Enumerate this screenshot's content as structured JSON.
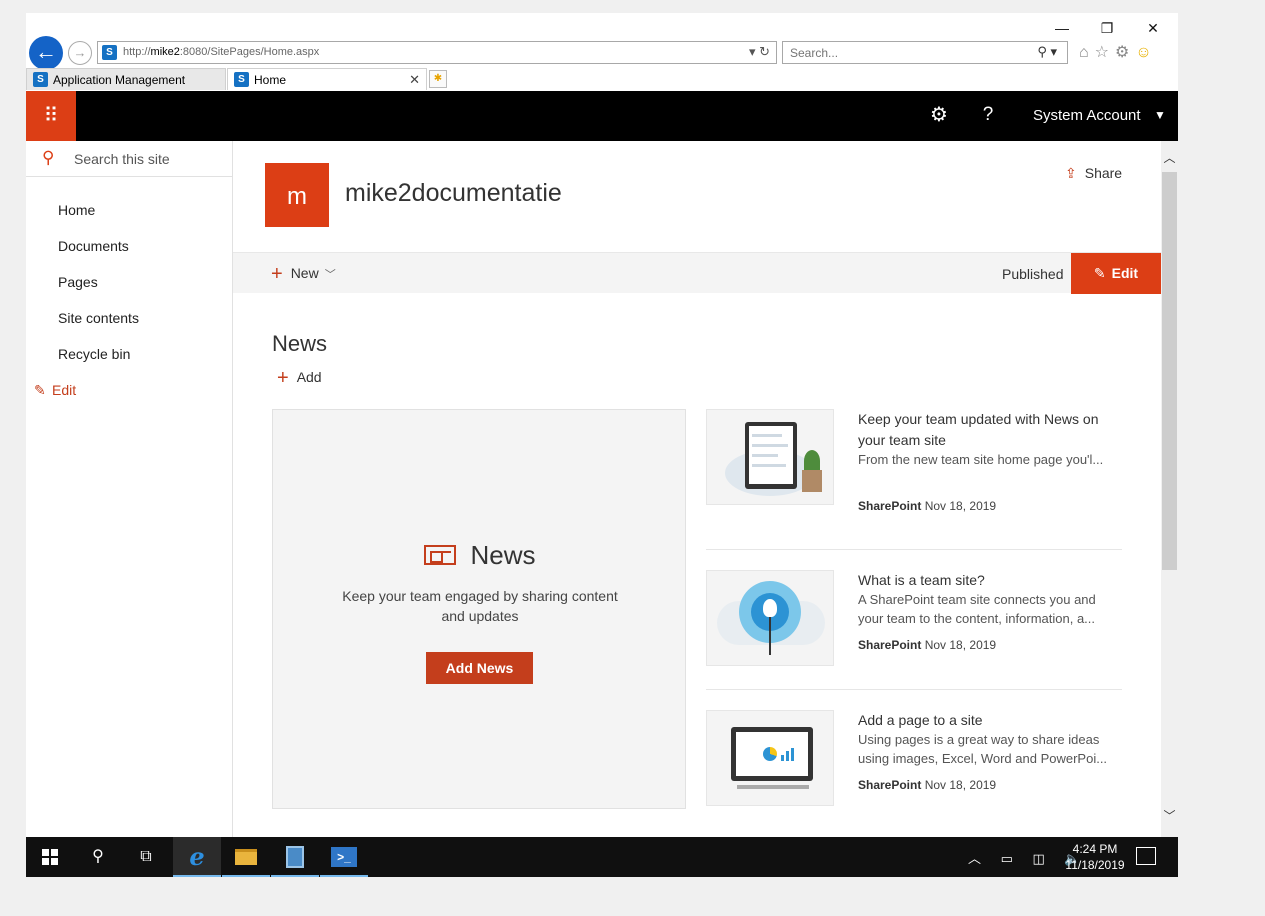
{
  "browser": {
    "window_controls": {
      "minimize": "—",
      "restore": "❐",
      "close": "✕"
    },
    "address": {
      "url_prefix": "http://",
      "url_host": "mike2",
      "url_rest": ":8080/SitePages/Home.aspx",
      "tools": "▾ ↻"
    },
    "search": {
      "placeholder": "Search...",
      "icon": "⚲ ▾"
    },
    "toolbar_icons": {
      "home": "⌂",
      "favorites": "☆",
      "settings": "⚙",
      "feedback": "☺"
    },
    "tabs": [
      {
        "label": "Application Management"
      },
      {
        "label": "Home",
        "close": "✕"
      }
    ],
    "new_tab": "✱"
  },
  "suite": {
    "waffle": "⠿",
    "settings_icon": "⚙",
    "help_icon": "?",
    "account": "System Account",
    "account_caret": "▼",
    "brand_color": "#dc3e15"
  },
  "leftnav": {
    "search_placeholder": "Search this site",
    "items": [
      {
        "label": "Home"
      },
      {
        "label": "Documents"
      },
      {
        "label": "Pages"
      },
      {
        "label": "Site contents"
      },
      {
        "label": "Recycle bin"
      }
    ],
    "edit": "Edit"
  },
  "site": {
    "logo_letter": "m",
    "title": "mike2documentatie",
    "share": "Share"
  },
  "commandbar": {
    "new_label": "New",
    "status": "Published",
    "edit": "Edit"
  },
  "news": {
    "heading": "News",
    "add_label": "Add",
    "hero": {
      "title": "News",
      "text": "Keep your team engaged by sharing content and updates",
      "button": "Add News"
    },
    "articles": [
      {
        "title": "Keep your team updated with News on your team site",
        "description": "From the new team site home page you'l...",
        "author": "SharePoint",
        "date": "Nov 18, 2019",
        "thumbnail_icon": "tablet-plant-illustration"
      },
      {
        "title": "What is a team site?",
        "description": "A SharePoint team site connects you and your team to the content, information, a...",
        "author": "SharePoint",
        "date": "Nov 18, 2019",
        "thumbnail_icon": "lightbulb-illustration"
      },
      {
        "title": "Add a page to a site",
        "description": "Using pages is a great way to share ideas using images, Excel, Word and PowerPoi...",
        "author": "SharePoint",
        "date": "Nov 18, 2019",
        "thumbnail_icon": "monitor-chart-illustration"
      }
    ]
  },
  "scrollbar": {
    "up": "︿",
    "down": "﹀"
  },
  "taskbar": {
    "search_icon": "⚲",
    "taskview_icon": "⧉",
    "powershell_label": ">_",
    "tray_icons": "︿ ▭ ◫ 🔈",
    "time": "4:24 PM",
    "date": "11/18/2019"
  }
}
